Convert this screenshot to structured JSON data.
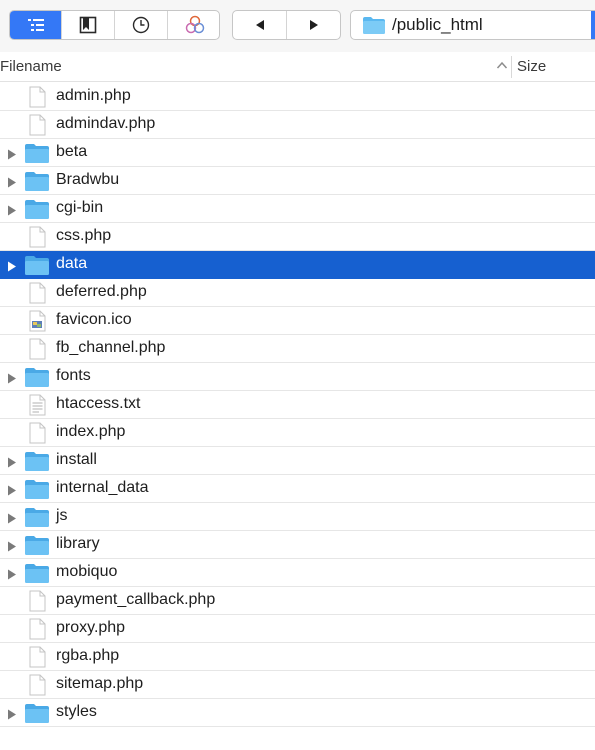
{
  "toolbar": {
    "view_buttons": [
      {
        "icon": "list-view-icon",
        "active": true
      },
      {
        "icon": "bookmarks-icon",
        "active": false
      },
      {
        "icon": "history-clock-icon",
        "active": false
      },
      {
        "icon": "sync-circles-icon",
        "active": false
      }
    ],
    "nav_buttons": [
      {
        "icon": "back-arrow-icon"
      },
      {
        "icon": "forward-arrow-icon"
      }
    ],
    "path": "/public_html",
    "path_icon": "folder-icon"
  },
  "header": {
    "filename_label": "Filename",
    "size_label": "Size",
    "sort_icon": "sort-ascending-icon"
  },
  "colors": {
    "accent": "#3478f6",
    "selection": "#1660d0",
    "folder": "#5ab8f0"
  },
  "files": [
    {
      "name": "admin.php",
      "type": "file"
    },
    {
      "name": "admindav.php",
      "type": "file"
    },
    {
      "name": "beta",
      "type": "folder"
    },
    {
      "name": "Bradwbu",
      "type": "folder"
    },
    {
      "name": "cgi-bin",
      "type": "folder"
    },
    {
      "name": "css.php",
      "type": "file"
    },
    {
      "name": "data",
      "type": "folder",
      "selected": true
    },
    {
      "name": "deferred.php",
      "type": "file"
    },
    {
      "name": "favicon.ico",
      "type": "image"
    },
    {
      "name": "fb_channel.php",
      "type": "file"
    },
    {
      "name": "fonts",
      "type": "folder"
    },
    {
      "name": "htaccess.txt",
      "type": "text"
    },
    {
      "name": "index.php",
      "type": "file"
    },
    {
      "name": "install",
      "type": "folder"
    },
    {
      "name": "internal_data",
      "type": "folder"
    },
    {
      "name": "js",
      "type": "folder"
    },
    {
      "name": "library",
      "type": "folder"
    },
    {
      "name": "mobiquo",
      "type": "folder"
    },
    {
      "name": "payment_callback.php",
      "type": "file"
    },
    {
      "name": "proxy.php",
      "type": "file"
    },
    {
      "name": "rgba.php",
      "type": "file"
    },
    {
      "name": "sitemap.php",
      "type": "file"
    },
    {
      "name": "styles",
      "type": "folder"
    }
  ]
}
